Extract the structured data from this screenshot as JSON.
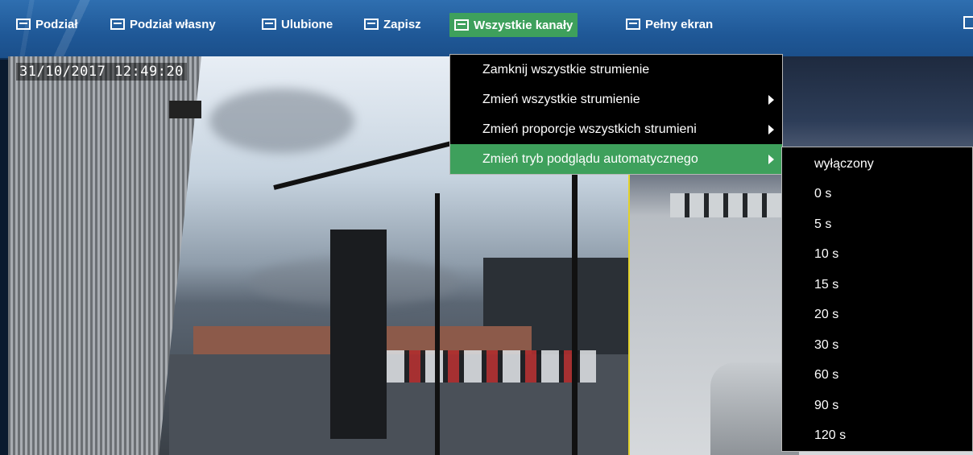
{
  "toolbar": {
    "items": [
      {
        "label": "Podział",
        "icon": "grid-icon"
      },
      {
        "label": "Podział własny",
        "icon": "custom-layout-icon"
      },
      {
        "label": "Ulubione",
        "icon": "favorites-icon"
      },
      {
        "label": "Zapisz",
        "icon": "save-icon"
      },
      {
        "label": "Wszystkie kanały",
        "icon": "all-channels-icon",
        "active": true
      },
      {
        "label": "Pełny ekran",
        "icon": "fullscreen-icon"
      }
    ],
    "active_color": "#3ea05c"
  },
  "camera1": {
    "timestamp": "31/10/2017 12:49:20"
  },
  "menu": {
    "items": [
      {
        "label": "Zamknij wszystkie strumienie",
        "has_submenu": false
      },
      {
        "label": "Zmień wszystkie strumienie",
        "has_submenu": true
      },
      {
        "label": "Zmień proporcje wszystkich strumieni",
        "has_submenu": true
      },
      {
        "label": "Zmień tryb podglądu automatycznego",
        "has_submenu": true,
        "active": true
      }
    ]
  },
  "submenu": {
    "items": [
      "wyłączony",
      "0 s",
      "5 s",
      "10 s",
      "15 s",
      "20 s",
      "30 s",
      "60 s",
      "90 s",
      "120 s"
    ]
  }
}
